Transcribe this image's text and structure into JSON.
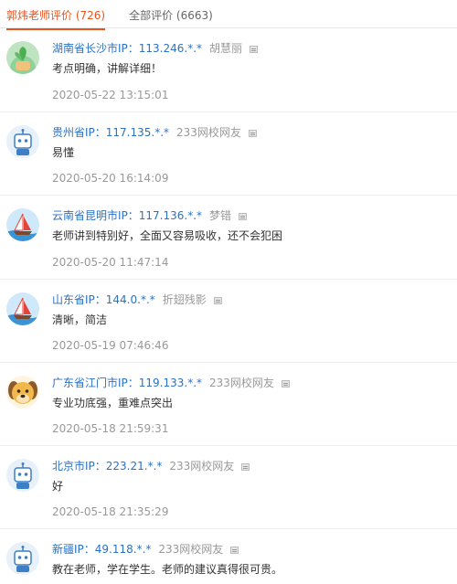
{
  "tabs": [
    {
      "label": "郭炜老师评价 (726)",
      "active": true
    },
    {
      "label": "全部评价 (6663)",
      "active": false
    }
  ],
  "comments": [
    {
      "location": "湖南省长沙市IP：113.246.*.*",
      "user": "胡慧丽",
      "text": "考点明确，讲解详细！",
      "time": "2020-05-22 13:15:01",
      "avatar": "plant-avatar-icon"
    },
    {
      "location": "贵州省IP：117.135.*.*",
      "user": "233网校网友",
      "text": "易懂",
      "time": "2020-05-20 16:14:09",
      "avatar": "robot-avatar-icon"
    },
    {
      "location": "云南省昆明市IP：117.136.*.*",
      "user": "梦错",
      "text": "老师讲到特别好，全面又容易吸收，还不会犯困",
      "time": "2020-05-20 11:47:14",
      "avatar": "sailboat-avatar-icon"
    },
    {
      "location": "山东省IP：144.0.*.*",
      "user": "折翅残影",
      "text": "清晰，简洁",
      "time": "2020-05-19 07:46:46",
      "avatar": "sailboat-avatar-icon"
    },
    {
      "location": "广东省江门市IP：119.133.*.*",
      "user": "233网校网友",
      "text": "专业功底强，重难点突出",
      "time": "2020-05-18 21:59:31",
      "avatar": "dog-avatar-icon"
    },
    {
      "location": "北京市IP：223.21.*.*",
      "user": "233网校网友",
      "text": "好",
      "time": "2020-05-18 21:35:29",
      "avatar": "robot-avatar-icon"
    },
    {
      "location": "新疆IP：49.118.*.*",
      "user": "233网校网友",
      "text": "教在老师，学在学生。老师的建议真得很可贵。",
      "time": "",
      "avatar": "robot-avatar-icon"
    }
  ],
  "colors": {
    "accent": "#e8541e",
    "link": "#2b72c2",
    "muted": "#999999"
  }
}
